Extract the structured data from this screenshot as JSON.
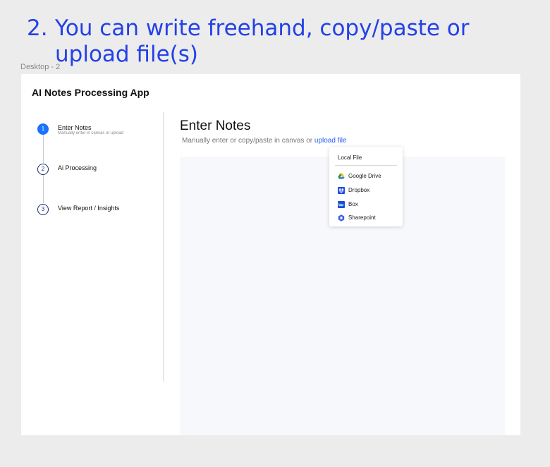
{
  "caption": {
    "number": "2.",
    "text": "You can write freehand, copy/paste or upload file(s)"
  },
  "frame": {
    "label": "Desktop - 2"
  },
  "app": {
    "title": "AI Notes Processing App"
  },
  "steps": [
    {
      "number": "1",
      "label": "Enter Notes",
      "sub": "Manually enter in canvas or upload",
      "active": true
    },
    {
      "number": "2",
      "label": "Ai Processing",
      "sub": "",
      "active": false
    },
    {
      "number": "3",
      "label": "View Report / Insights",
      "sub": "",
      "active": false
    }
  ],
  "main": {
    "title": "Enter Notes",
    "subtitle_prefix": "Manually enter or copy/paste in canvas or ",
    "upload_link": "upload file"
  },
  "dropdown": {
    "local": "Local File",
    "items": [
      {
        "label": "Google Drive",
        "icon": "google-drive-icon"
      },
      {
        "label": "Dropbox",
        "icon": "dropbox-icon"
      },
      {
        "label": "Box",
        "icon": "box-icon"
      },
      {
        "label": "Sharepoint",
        "icon": "sharepoint-icon"
      }
    ]
  },
  "colors": {
    "accent": "#1a73ff",
    "caption": "#2441e6",
    "link": "#2a5cf0",
    "canvas": "#f7f8fc"
  }
}
